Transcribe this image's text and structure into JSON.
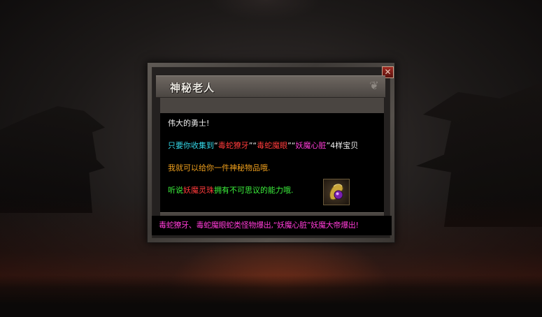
{
  "dialog": {
    "title": "神秘老人",
    "close_label": "✕",
    "greeting": "伟大的勇士!",
    "collect_line": {
      "prefix": "只要你收集到",
      "q1": "“",
      "item1": "毒蛇獠牙",
      "q2": "”“",
      "item2": "毒蛇魔眼",
      "q3": "”“",
      "item3": "妖魔心脏",
      "suffix": "”4样宝贝"
    },
    "reward_line": "我就可以给你一件神秘物品哦.",
    "hint_line": {
      "prefix": "听说",
      "item": "妖魔灵珠",
      "suffix": "拥有不可思议的能力哦."
    },
    "item_slot_icon": "orb-icon",
    "footer": "毒蛇獠牙、毒蛇魔眼蛇类怪物爆出,“妖魔心脏”妖魔大帝爆出!"
  },
  "colors": {
    "cyan": "#34d7e8",
    "red": "#ff3b3b",
    "magenta": "#ff3bd6",
    "orange": "#f0a01c",
    "green": "#3cf03c"
  }
}
